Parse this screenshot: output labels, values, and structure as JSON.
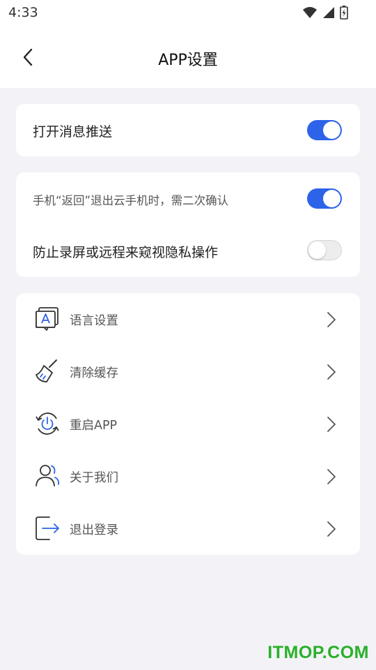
{
  "status_bar": {
    "time": "4:33"
  },
  "header": {
    "title": "APP设置"
  },
  "card_push": {
    "label": "打开消息推送",
    "enabled": true
  },
  "card_security": {
    "items": [
      {
        "label": "手机“返回”退出云手机时，需二次确认",
        "enabled": true
      },
      {
        "label": "防止录屏或远程来窥视隐私操作",
        "enabled": false
      }
    ]
  },
  "menu": {
    "items": [
      {
        "label": "语言设置",
        "icon": "language-icon"
      },
      {
        "label": "清除缓存",
        "icon": "broom-icon"
      },
      {
        "label": "重启APP",
        "icon": "restart-icon"
      },
      {
        "label": "关于我们",
        "icon": "users-icon"
      },
      {
        "label": "退出登录",
        "icon": "logout-icon"
      }
    ]
  },
  "watermark": "ITMOP.COM",
  "colors": {
    "accent": "#2d63e8",
    "background": "#f3f3f7",
    "watermark": "#29b029"
  }
}
